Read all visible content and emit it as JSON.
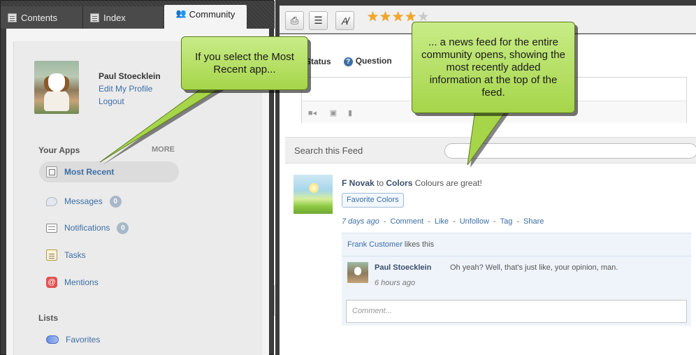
{
  "tabs": {
    "contents": "Contents",
    "index": "Index",
    "community": "Community"
  },
  "profile": {
    "name": "Paul Stoecklein",
    "edit_link": "Edit My Profile",
    "logout_link": "Logout"
  },
  "apps": {
    "heading": "Your Apps",
    "more": "MORE",
    "items": [
      {
        "label": "Most Recent",
        "icon": "most-recent-icon"
      },
      {
        "label": "Messages",
        "icon": "messages-icon",
        "count": "0"
      },
      {
        "label": "Notifications",
        "icon": "notifications-icon",
        "count": "0"
      },
      {
        "label": "Tasks",
        "icon": "tasks-icon"
      },
      {
        "label": "Mentions",
        "icon": "mentions-icon",
        "glyph": "@"
      }
    ]
  },
  "lists": {
    "heading": "Lists",
    "items": [
      {
        "label": "Favorites",
        "icon": "favorites-icon"
      }
    ]
  },
  "toolbar": {
    "print_icon": "print-icon",
    "toc_icon": "list-icon",
    "clear_icon": "clear-highlight-icon",
    "rating": {
      "filled": 4,
      "total": 5
    }
  },
  "composer": {
    "tab_status": "Status",
    "tab_question": "Question"
  },
  "feed": {
    "search_label": "Search this Feed",
    "post": {
      "author": "F Novak",
      "connector": "to",
      "group": "Colors",
      "text": "Colours are great!",
      "tag": "Favorite Colors",
      "ago": "7 days ago",
      "actions": [
        "Comment",
        "Like",
        "Unfollow",
        "Tag",
        "Share"
      ],
      "likes_name": "Frank Customer",
      "likes_suffix": "likes this",
      "comment": {
        "author": "Paul Stoecklein",
        "text": "Oh yeah? Well, that's just like, your opinion, man.",
        "time": "6 hours ago"
      },
      "comment_placeholder": "Comment..."
    }
  },
  "callouts": {
    "left": "If you select the Most Recent app...",
    "right": "... a news feed for the entire community opens, showing the most recently added information at the top of the feed."
  },
  "colors": {
    "callout_fill": "#b6e05f",
    "link_blue": "#3b6ea5",
    "star": "#f5a623"
  }
}
